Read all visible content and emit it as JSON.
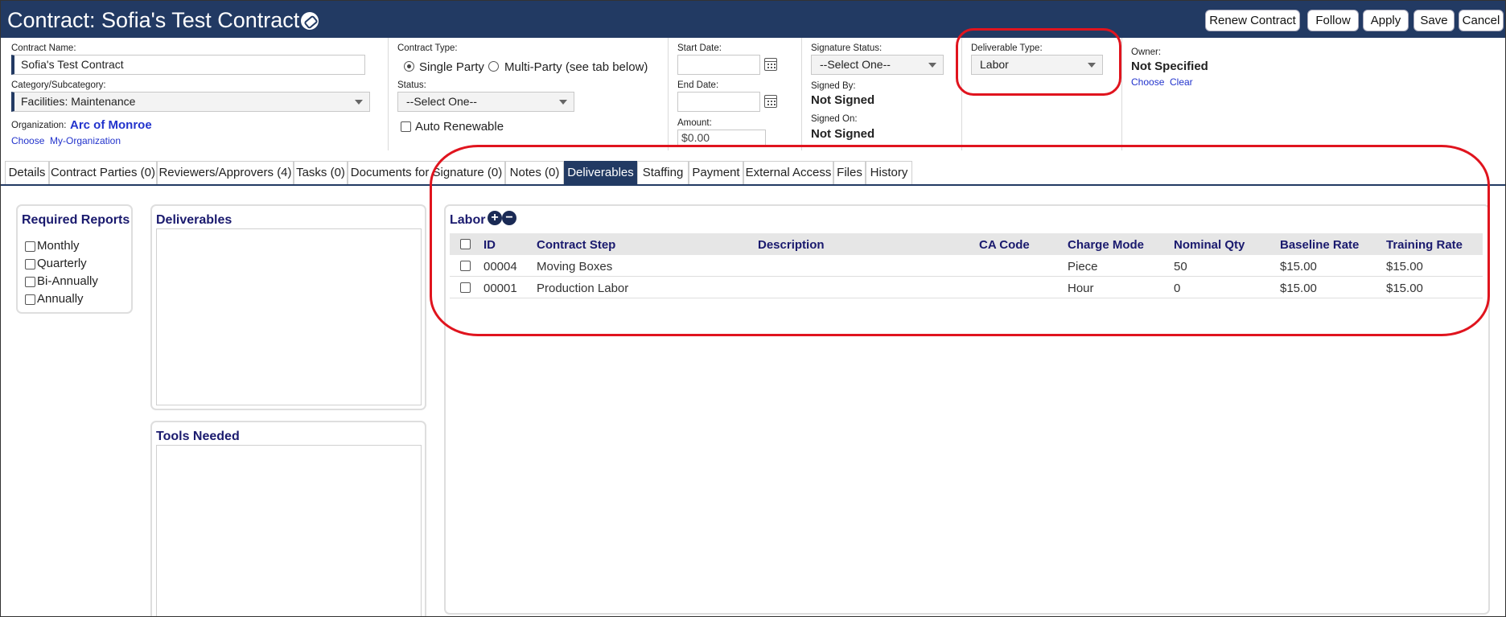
{
  "header": {
    "title": "Contract: Sofia's Test Contract",
    "buttons": {
      "renew": "Renew Contract",
      "follow": "Follow",
      "apply": "Apply",
      "save": "Save",
      "cancel": "Cancel"
    }
  },
  "form": {
    "contract_name": {
      "label": "Contract Name:",
      "value": "Sofia's Test Contract"
    },
    "category": {
      "label": "Category/Subcategory:",
      "value": "Facilities: Maintenance"
    },
    "organization": {
      "label": "Organization:",
      "value": "Arc of Monroe",
      "choose": "Choose",
      "my_org": "My-Organization"
    },
    "contract_type": {
      "label": "Contract Type:",
      "single": "Single Party",
      "multi": "Multi-Party (see tab below)",
      "selected": "Single Party"
    },
    "status": {
      "label": "Status:",
      "value": "--Select One--"
    },
    "auto_renewable": {
      "label": "Auto Renewable",
      "checked": false
    },
    "start_date": {
      "label": "Start Date:",
      "value": ""
    },
    "end_date": {
      "label": "End Date:",
      "value": ""
    },
    "amount": {
      "label": "Amount:",
      "value": "$0.00"
    },
    "signature_status": {
      "label": "Signature Status:",
      "value": "--Select One--"
    },
    "signed_by": {
      "label": "Signed By:",
      "value": "Not Signed"
    },
    "signed_on": {
      "label": "Signed On:",
      "value": "Not Signed"
    },
    "deliverable_type": {
      "label": "Deliverable Type:",
      "value": "Labor"
    },
    "owner": {
      "label": "Owner:",
      "value": "Not Specified",
      "choose": "Choose",
      "clear": "Clear"
    }
  },
  "tabs": [
    {
      "label": "Details"
    },
    {
      "label": "Contract Parties (0)"
    },
    {
      "label": "Reviewers/Approvers (4)"
    },
    {
      "label": "Tasks (0)"
    },
    {
      "label": "Documents for Signature (0)"
    },
    {
      "label": "Notes (0)"
    },
    {
      "label": "Deliverables",
      "active": true
    },
    {
      "label": "Staffing"
    },
    {
      "label": "Payment"
    },
    {
      "label": "External Access"
    },
    {
      "label": "Files"
    },
    {
      "label": "History"
    }
  ],
  "required_reports": {
    "title": "Required Reports",
    "items": [
      "Monthly",
      "Quarterly",
      "Bi-Annually",
      "Annually"
    ]
  },
  "deliverables_panel": {
    "title": "Deliverables"
  },
  "tools_panel": {
    "title": "Tools Needed"
  },
  "labor": {
    "title": "Labor",
    "add_icon": "+",
    "remove_icon": "−",
    "columns": [
      "ID",
      "Contract Step",
      "Description",
      "CA Code",
      "Charge Mode",
      "Nominal Qty",
      "Baseline Rate",
      "Training Rate"
    ],
    "rows": [
      {
        "id": "00004",
        "step": "Moving Boxes",
        "description": "",
        "ca_code": "",
        "charge_mode": "Piece",
        "qty": "50",
        "baseline": "$15.00",
        "training": "$15.00"
      },
      {
        "id": "00001",
        "step": "Production Labor",
        "description": "",
        "ca_code": "",
        "charge_mode": "Hour",
        "qty": "0",
        "baseline": "$15.00",
        "training": "$15.00"
      }
    ]
  },
  "colors": {
    "header_bg": "#223a63",
    "link": "#2233cc",
    "heading": "#1a1a6e",
    "annotation": "#e0141e"
  }
}
